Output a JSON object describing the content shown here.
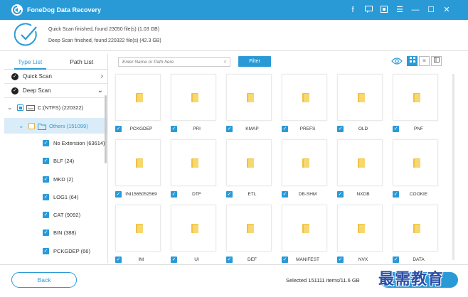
{
  "app": {
    "title": "FoneDog Data Recovery"
  },
  "titlebar": {
    "icons": [
      "facebook-icon",
      "feedback-icon",
      "register-icon",
      "menu-icon",
      "minimize-icon",
      "maximize-icon",
      "close-icon"
    ]
  },
  "summary": {
    "quick_scan": "Quick Scan finished, found 23050 file(s) (1.03 GB)",
    "deep_scan": "Deep Scan finished, found 220322 file(s) (42.3 GB)"
  },
  "left_panel": {
    "tabs": [
      "Type List",
      "Path List"
    ],
    "active_tab": "Type List",
    "quick_scan_label": "Quick Scan",
    "deep_scan_label": "Deep Scan",
    "drive": "C:(NTFS) (220322)",
    "others": "Others (151099)",
    "items": [
      "No Extension (63614)",
      "BLF (24)",
      "MKD (2)",
      "LOG1 (64)",
      "CAT (9092)",
      "BIN (388)",
      "PCKGDEP (66)"
    ]
  },
  "toolbar": {
    "search_placeholder": "Enter Name or Path here",
    "filter_label": "Filter"
  },
  "files": [
    "PCKGDEP",
    "PRI",
    "KMAP",
    "PREFS",
    "OLD",
    "PNF",
    "INI1565052569",
    "DTF",
    "ETL",
    "DB-SHM",
    "NXDB",
    "COOKIE",
    "INI",
    "UI",
    "DEF",
    "MANIFEST",
    "NVX",
    "DATA"
  ],
  "bottom": {
    "back_label": "Back",
    "selected_info": "Selected 151111 items/11.6 GB",
    "watermark": "最需教育"
  },
  "colors": {
    "accent": "#2a9ad7",
    "folder": "#f0c040"
  }
}
